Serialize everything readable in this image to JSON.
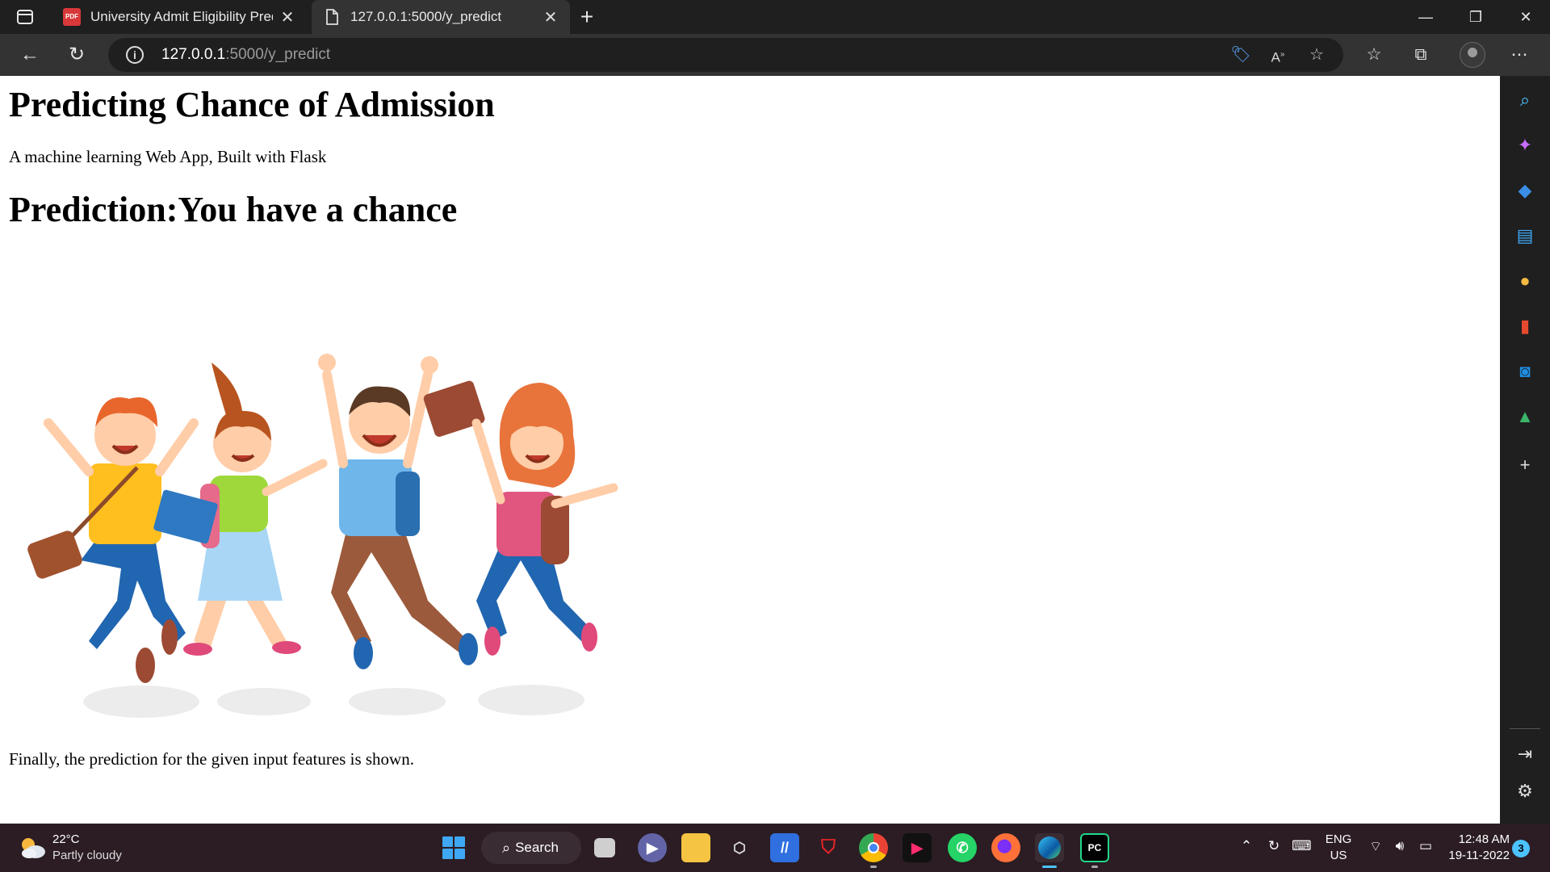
{
  "browser": {
    "tabs": [
      {
        "title": "University Admit Eligibility Predic",
        "active": false
      },
      {
        "title": "127.0.0.1:5000/y_predict",
        "active": true
      }
    ],
    "address": {
      "host": "127.0.0.1",
      "path": ":5000/y_predict"
    }
  },
  "page": {
    "heading": "Predicting Chance of Admission",
    "subtitle": "A machine learning Web App, Built with Flask",
    "prediction": "Prediction:You have a chance",
    "footer_text": "Finally, the prediction for the given input features is shown."
  },
  "sidebar_icons": [
    "search-icon",
    "copilot-icon",
    "shopping-icon",
    "tools-icon",
    "games-icon",
    "office-icon",
    "outlook-icon",
    "drop-icon",
    "add-icon",
    "split-screen-icon",
    "settings-icon"
  ],
  "taskbar": {
    "weather": {
      "temp": "22°C",
      "desc": "Partly cloudy"
    },
    "search_label": "Search",
    "lang": {
      "line1": "ENG",
      "line2": "US"
    },
    "clock": {
      "time": "12:48 AM",
      "date": "19-11-2022"
    },
    "notification_count": "3"
  },
  "colors": {
    "accent": "#4cc2ff",
    "tab_active": "#333333",
    "taskbar_bg": "#2b1d23"
  }
}
